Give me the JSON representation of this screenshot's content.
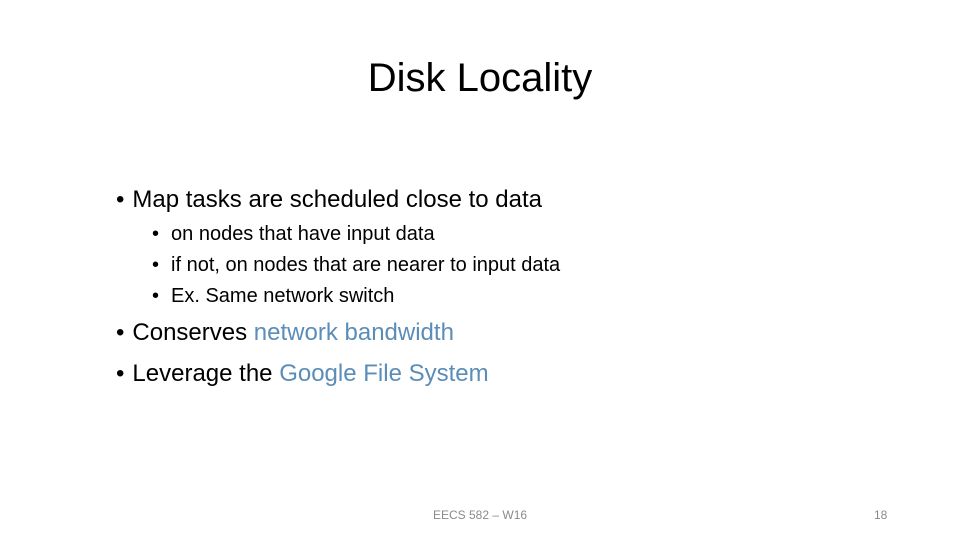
{
  "slide": {
    "title": "Disk Locality",
    "bullets": [
      {
        "text": "Map tasks are scheduled close to data"
      },
      {
        "text": "on nodes that have input data"
      },
      {
        "text": "if not, on nodes that are nearer to input data"
      },
      {
        "text": "Ex. Same network switch"
      },
      {
        "prefix": "Conserves ",
        "highlight": "network bandwidth"
      },
      {
        "prefix": "Leverage the ",
        "highlight": "Google File System"
      }
    ],
    "bullet_glyph": "•",
    "highlight_color": "#5b8db8"
  },
  "footer": {
    "course": "EECS 582 – W16",
    "page_number": "18"
  }
}
